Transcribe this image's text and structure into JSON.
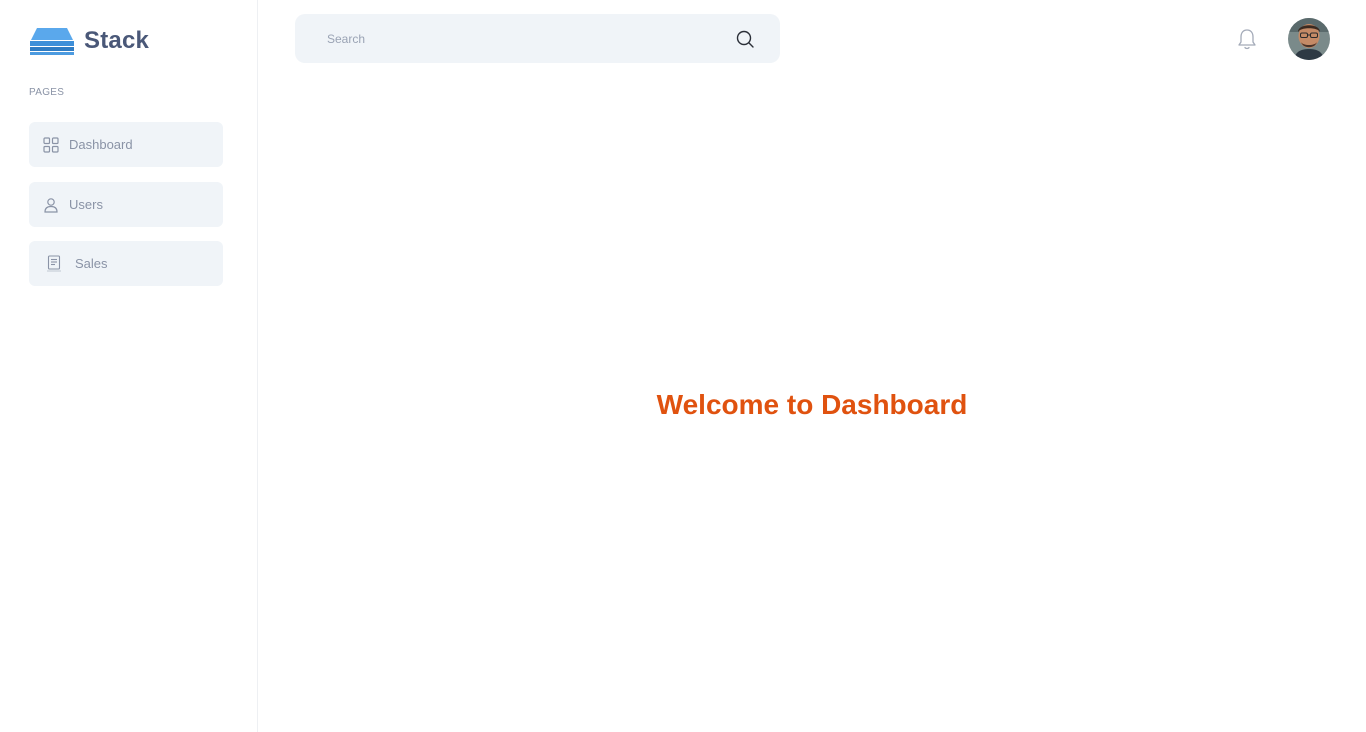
{
  "app": {
    "name": "Stack",
    "accent_color": "#e0520f",
    "logo_color": "#3d8fd9"
  },
  "sidebar": {
    "section_label": "PAGES",
    "items": [
      {
        "label": "Dashboard",
        "icon": "grid-icon"
      },
      {
        "label": "Users",
        "icon": "user-icon"
      },
      {
        "label": "Sales",
        "icon": "receipt-icon"
      }
    ]
  },
  "header": {
    "search": {
      "placeholder": "Search",
      "value": ""
    },
    "notifications_icon": "bell-icon",
    "avatar_icon": "user-avatar"
  },
  "main": {
    "welcome_text": "Welcome to Dashboard"
  }
}
